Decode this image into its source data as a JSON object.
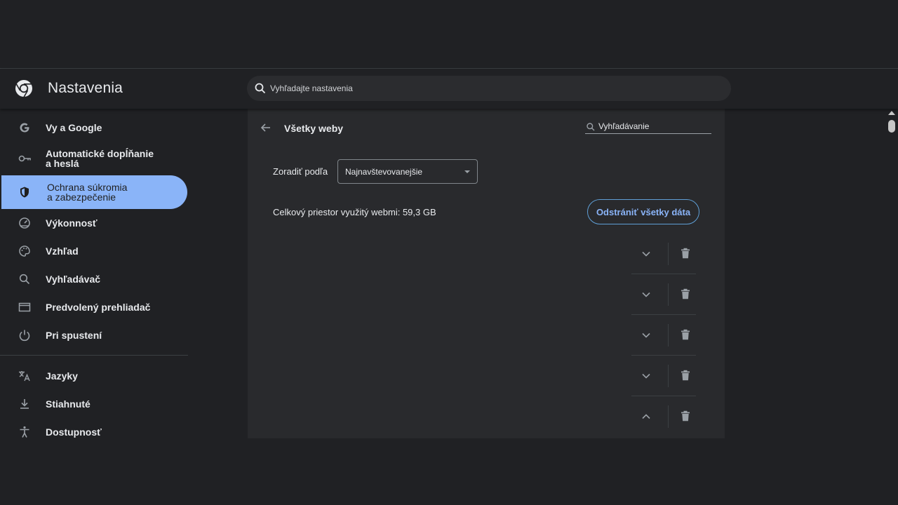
{
  "header": {
    "title": "Nastavenia",
    "search_placeholder": "Vyhľadajte nastavenia"
  },
  "sidebar": {
    "items": [
      {
        "label": "Vy a Google",
        "icon": "google-g-icon"
      },
      {
        "label_line1": "Automatické dopĺňanie",
        "label_line2": "a heslá",
        "icon": "key-icon"
      },
      {
        "label_line1": "Ochrana súkromia",
        "label_line2": "a zabezpečenie",
        "icon": "shield-icon",
        "active": true
      },
      {
        "label": "Výkonnosť",
        "icon": "speedometer-icon"
      },
      {
        "label": "Vzhľad",
        "icon": "palette-icon"
      },
      {
        "label": "Vyhľadávač",
        "icon": "search-icon"
      },
      {
        "label": "Predvolený prehliadač",
        "icon": "browser-window-icon"
      },
      {
        "label": "Pri spustení",
        "icon": "power-icon"
      },
      {
        "label": "Jazyky",
        "icon": "translate-icon"
      },
      {
        "label": "Stiahnuté",
        "icon": "download-icon"
      },
      {
        "label": "Dostupnosť",
        "icon": "accessibility-icon"
      }
    ]
  },
  "panel": {
    "title": "Všetky weby",
    "search_placeholder": "Vyhľadávanie",
    "sort_label": "Zoradiť podľa",
    "sort_value": "Najnavštevovanejšie",
    "storage_text": "Celkový priestor využitý webmi: 59,3 GB",
    "clear_button": "Odstrániť všetky dáta",
    "rows": [
      {
        "expanded": false
      },
      {
        "expanded": false
      },
      {
        "expanded": false
      },
      {
        "expanded": false
      },
      {
        "expanded": true
      }
    ]
  },
  "colors": {
    "background": "#202124",
    "panel": "#292a2d",
    "accent": "#8ab4f8",
    "text": "#e8eaed"
  }
}
